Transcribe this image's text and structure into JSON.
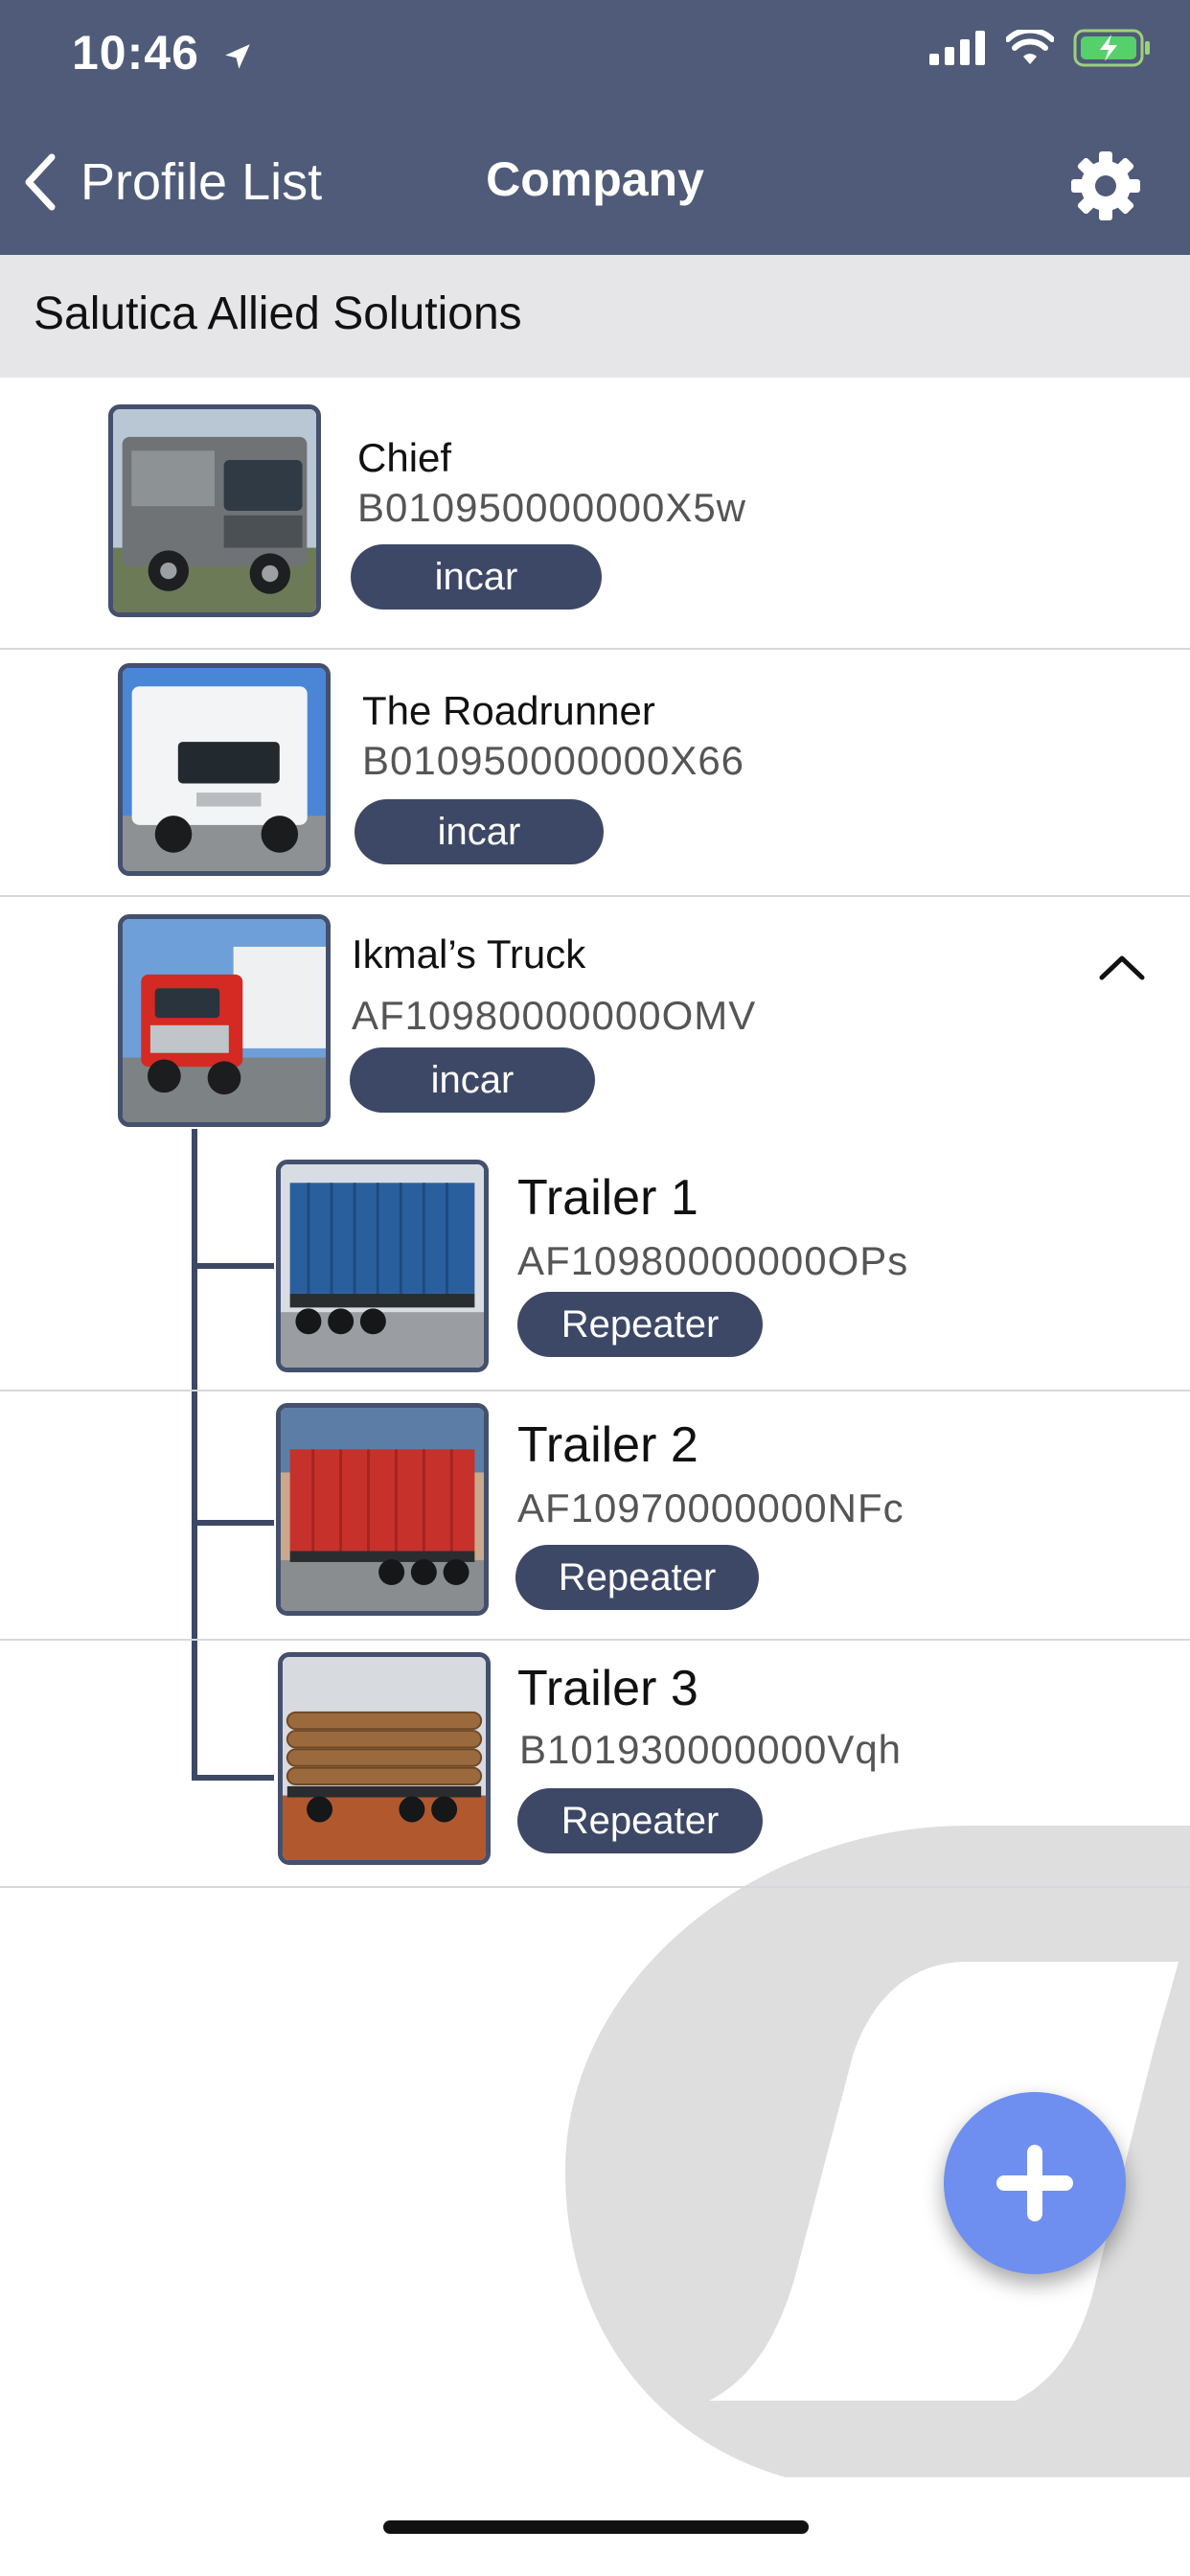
{
  "status_bar": {
    "time": "10:46"
  },
  "nav": {
    "back_label": "Profile List",
    "title": "Company"
  },
  "company": {
    "name": "Salutica Allied Solutions"
  },
  "vehicles": [
    {
      "name": "Chief",
      "code": "B010950000000X5w",
      "tag": "incar",
      "icon": "grey-truck"
    },
    {
      "name": "The Roadrunner",
      "code": "B010950000000X66",
      "tag": "incar",
      "icon": "white-motorhome"
    },
    {
      "name": "Ikmal’s Truck",
      "code": "AF10980000000OMV",
      "tag": "incar",
      "icon": "red-semi-truck"
    }
  ],
  "trailers": [
    {
      "name": "Trailer 1",
      "code": "AF10980000000OPs",
      "tag": "Repeater",
      "icon": "blue-container-trailer"
    },
    {
      "name": "Trailer 2",
      "code": "AF10970000000NFc",
      "tag": "Repeater",
      "icon": "red-container-trailer"
    },
    {
      "name": "Trailer 3",
      "code": "B101930000000Vqh",
      "tag": "Repeater",
      "icon": "log-trailer"
    }
  ],
  "colors": {
    "header": "#4f5b78",
    "pill": "#3d4866",
    "fab": "#6e8ff0"
  }
}
